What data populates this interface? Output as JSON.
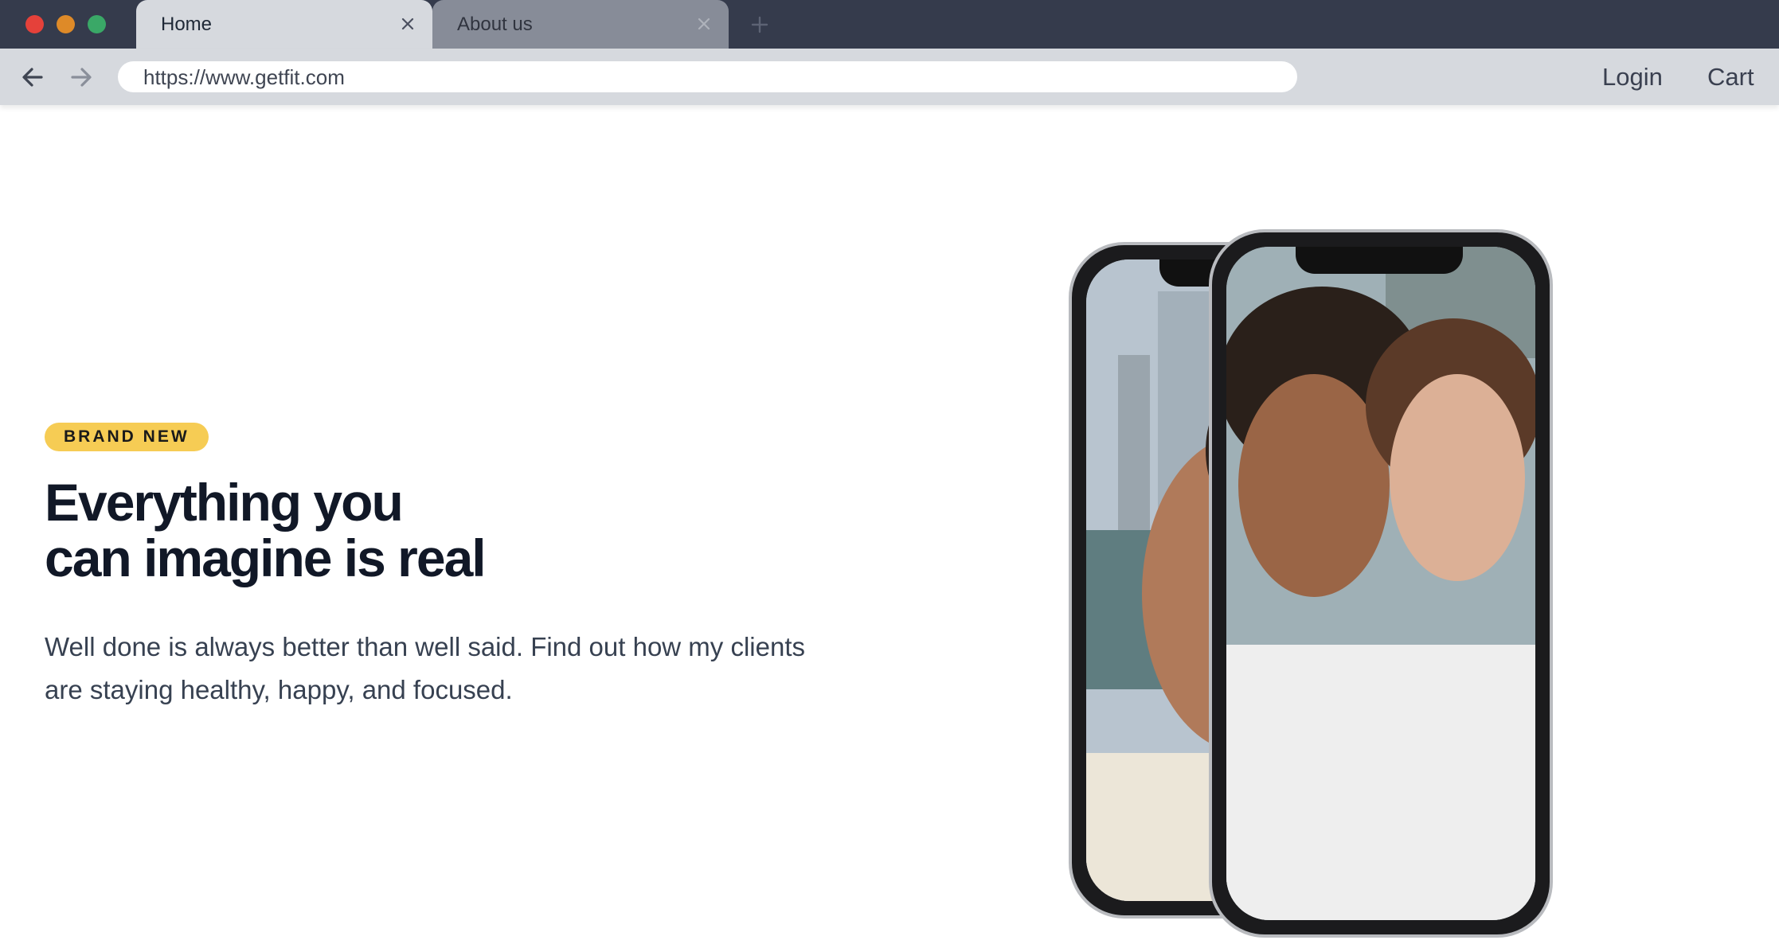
{
  "browser": {
    "tabs": [
      {
        "label": "Home",
        "active": true
      },
      {
        "label": "About us",
        "active": false
      }
    ],
    "url": "https://www.getfit.com",
    "nav": {
      "login": "Login",
      "cart": "Cart"
    },
    "icons": {
      "back": "arrow-left-icon",
      "forward": "arrow-right-icon",
      "close": "close-icon",
      "new_tab": "plus-icon"
    }
  },
  "hero": {
    "badge": "BRAND NEW",
    "title_line1": "Everything you",
    "title_line2": "can imagine is real",
    "text": "Well done is always better than well said. Find out how my clients are staying healthy, happy, and focused."
  },
  "colors": {
    "titlebar": "#353b4c",
    "toolbar": "#d6d9de",
    "badge": "#f6cc54",
    "heading": "#111827"
  }
}
